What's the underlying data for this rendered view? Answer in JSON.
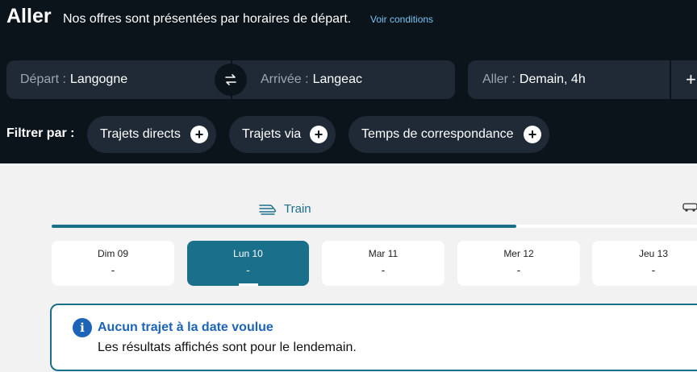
{
  "header": {
    "title": "Aller",
    "subtitle": "Nos offres sont présentées par horaires de départ.",
    "conditions_link": "Voir conditions"
  },
  "search": {
    "departure_label": "Départ :",
    "departure_value": "Langogne",
    "arrival_label": "Arrivée :",
    "arrival_value": "Langeac",
    "date_label": "Aller :",
    "date_value": "Demain, 4h",
    "add_label": "+"
  },
  "filters": {
    "label": "Filtrer par :",
    "chips": [
      "Trajets directs",
      "Trajets via",
      "Temps de correspondance"
    ]
  },
  "mode_tabs": {
    "train_label": "Train",
    "active_tab_progress_percent": 72
  },
  "days": [
    {
      "label": "Dim 09",
      "price": "-"
    },
    {
      "label": "Lun 10",
      "price": "-",
      "selected": true
    },
    {
      "label": "Mar 11",
      "price": "-"
    },
    {
      "label": "Mer 12",
      "price": "-"
    },
    {
      "label": "Jeu 13",
      "price": "-"
    }
  ],
  "notice": {
    "title": "Aucun trajet à la date voulue",
    "text": "Les résultats affichés sont pour le lendemain."
  },
  "colors": {
    "header_bg": "#0b131b",
    "field_bg": "#1f2a36",
    "accent": "#1a6f8a",
    "info_blue": "#1d63b8",
    "link": "#78c4f0"
  }
}
